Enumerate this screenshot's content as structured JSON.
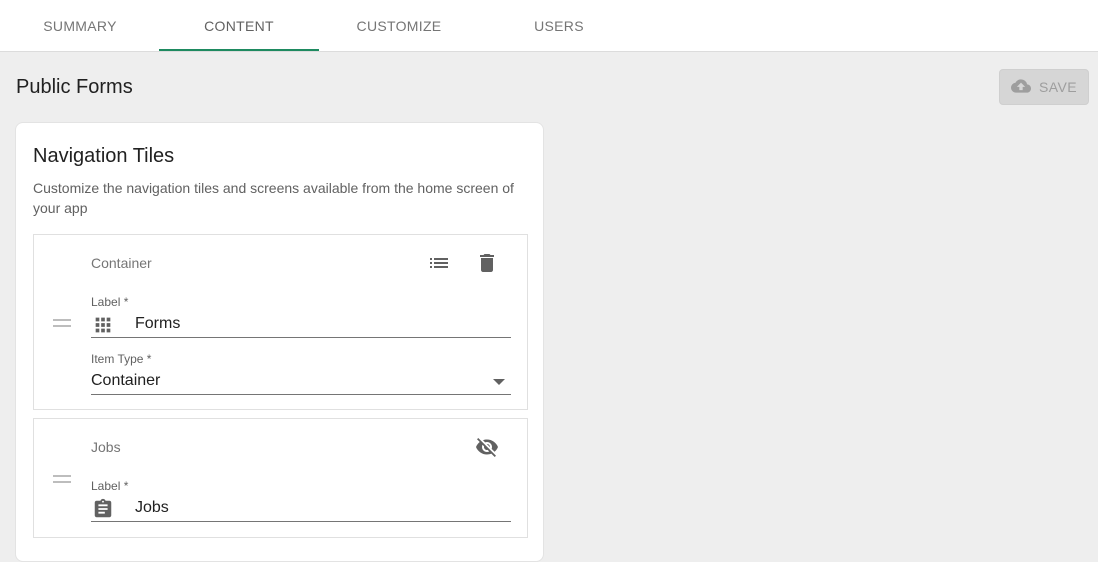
{
  "tabs": [
    {
      "label": "SUMMARY",
      "active": false
    },
    {
      "label": "CONTENT",
      "active": true
    },
    {
      "label": "CUSTOMIZE",
      "active": false
    },
    {
      "label": "USERS",
      "active": false
    }
  ],
  "colors": {
    "accent": "#1e8a60",
    "background": "#eeeeee",
    "disabled": "#9e9e9e"
  },
  "page": {
    "title": "Public Forms",
    "save_label": "SAVE",
    "save_icon": "cloud-upload-icon",
    "save_disabled": true
  },
  "card": {
    "title": "Navigation Tiles",
    "description": "Customize the navigation tiles and screens available from the home screen of your app",
    "tiles": [
      {
        "name": "Container",
        "actions": [
          "list-icon",
          "delete-icon"
        ],
        "label_field": {
          "label": "Label *",
          "value": "Forms",
          "icon": "apps-grid-icon"
        },
        "type_field": {
          "label": "Item Type *",
          "value": "Container"
        }
      },
      {
        "name": "Jobs",
        "actions": [
          "visibility-off-icon"
        ],
        "label_field": {
          "label": "Label *",
          "value": "Jobs",
          "icon": "clipboard-icon"
        }
      }
    ]
  }
}
